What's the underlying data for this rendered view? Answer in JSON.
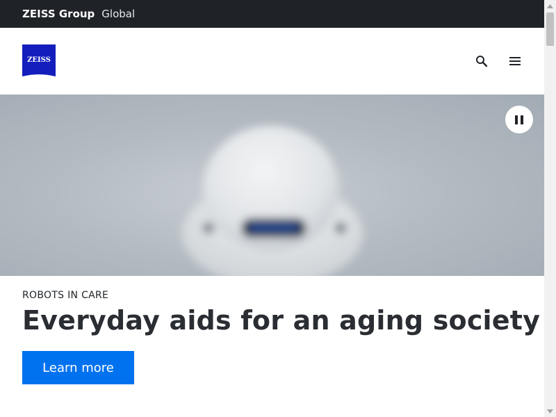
{
  "topbar": {
    "brand": "ZEISS Group",
    "region": "Global"
  },
  "header": {
    "logo_text": "ZEISS",
    "brand_color": "#141ebd",
    "icons": {
      "search": "search-icon",
      "menu": "hamburger-menu-icon"
    }
  },
  "hero": {
    "pause_icon": "pause-icon"
  },
  "teaser": {
    "eyebrow": "ROBOTS IN CARE",
    "headline": "Everyday aids for an aging society",
    "cta_label": "Learn more",
    "cta_color": "#0072ef"
  }
}
